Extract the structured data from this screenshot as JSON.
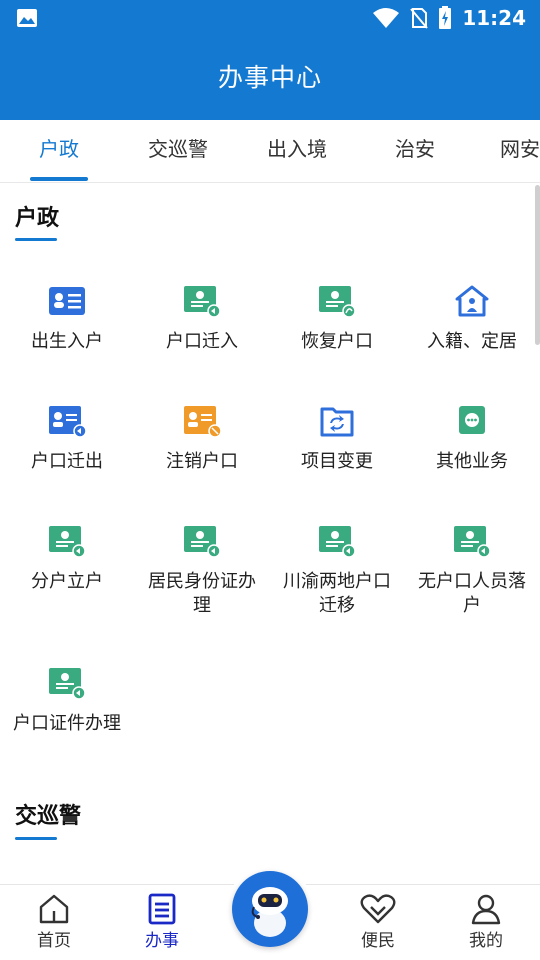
{
  "status_bar": {
    "time": "11:24"
  },
  "header": {
    "title": "办事中心"
  },
  "tabs": [
    {
      "label": "户政",
      "active": true
    },
    {
      "label": "交巡警"
    },
    {
      "label": "出入境"
    },
    {
      "label": "治安"
    },
    {
      "label": "网安"
    }
  ],
  "sections": [
    {
      "title": "户政",
      "items": [
        {
          "label": "出生入户",
          "icon": "id-card-icon"
        },
        {
          "label": "户口迁入",
          "icon": "certificate-in-icon"
        },
        {
          "label": "恢复户口",
          "icon": "certificate-restore-icon"
        },
        {
          "label": "入籍、定居",
          "icon": "home-person-icon"
        },
        {
          "label": "户口迁出",
          "icon": "certificate-out-icon"
        },
        {
          "label": "注销户口",
          "icon": "certificate-cancel-icon"
        },
        {
          "label": "项目变更",
          "icon": "folder-refresh-icon"
        },
        {
          "label": "其他业务",
          "icon": "chat-more-icon"
        },
        {
          "label": "分户立户",
          "icon": "certificate-icon"
        },
        {
          "label": "居民身份证办理",
          "icon": "certificate-icon"
        },
        {
          "label": "川渝两地户口迁移",
          "icon": "certificate-icon"
        },
        {
          "label": "无户口人员落户",
          "icon": "certificate-icon"
        },
        {
          "label": "户口证件办理",
          "icon": "certificate-icon"
        }
      ]
    },
    {
      "title": "交巡警"
    }
  ],
  "bottom_nav": [
    {
      "label": "首页",
      "icon": "home-icon"
    },
    {
      "label": "办事",
      "icon": "document-icon",
      "active": true
    },
    {
      "label": "便民",
      "icon": "heart-icon"
    },
    {
      "label": "我的",
      "icon": "user-icon"
    }
  ],
  "colors": {
    "primary": "#1479d0",
    "green": "#3aaa80",
    "orange": "#f09a2a",
    "active_nav": "#1a28c6"
  }
}
